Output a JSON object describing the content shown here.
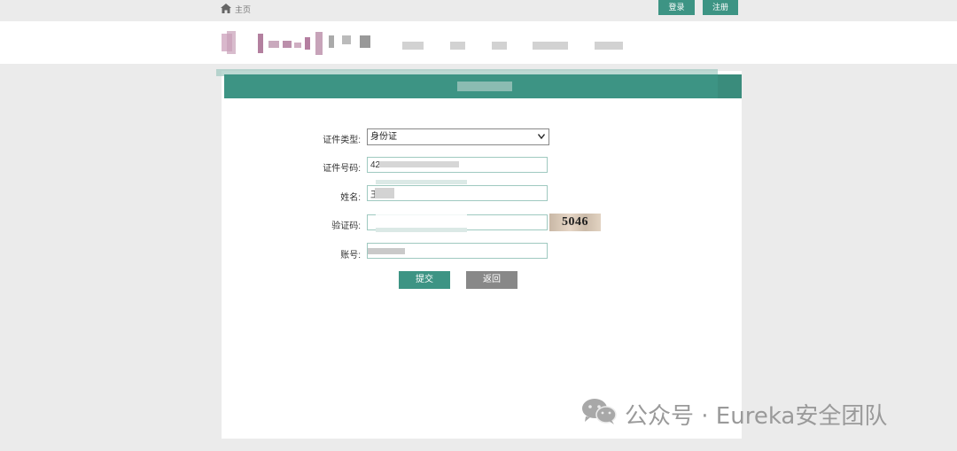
{
  "topbar": {
    "home_label": "主页",
    "login_label": "登录",
    "register_label": "注册"
  },
  "form": {
    "id_type_label": "证件类型:",
    "id_type_value": "身份证",
    "id_number_label": "证件号码:",
    "id_number_value": "42",
    "name_label": "姓名:",
    "name_value": "王",
    "captcha_label": "验证码:",
    "captcha_value": "",
    "captcha_image_text": "5046",
    "account_label": "账号:",
    "account_value": "",
    "submit_label": "提交",
    "back_label": "返回"
  },
  "watermark": {
    "text": "公众号 · Eureka安全团队"
  },
  "colors": {
    "accent": "#3d9484",
    "back_button": "#888888",
    "background": "#ebebeb"
  }
}
